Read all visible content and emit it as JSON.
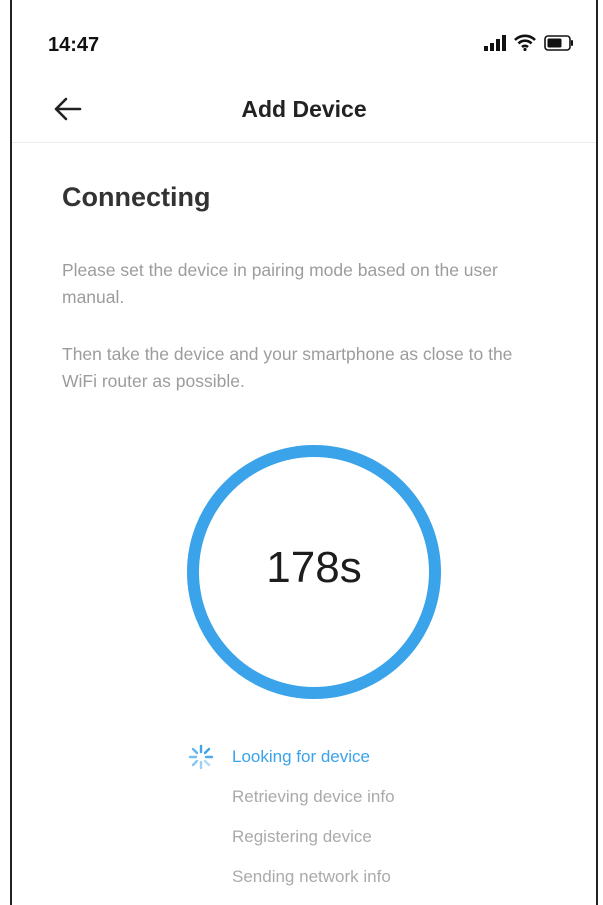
{
  "status": {
    "time": "14:47"
  },
  "header": {
    "title": "Add Device"
  },
  "content": {
    "heading": "Connecting",
    "instruction_1": "Please set the device in pairing mode based on the user manual.",
    "instruction_2": "Then take the device and your smartphone as close to the WiFi router as possible."
  },
  "timer": {
    "value": "178s"
  },
  "steps": [
    {
      "label": "Looking for device",
      "active": true
    },
    {
      "label": "Retrieving device info",
      "active": false
    },
    {
      "label": "Registering device",
      "active": false
    },
    {
      "label": "Sending network info",
      "active": false
    }
  ],
  "colors": {
    "accent": "#3aa3ea",
    "ring": "#3aa3ea",
    "muted_text": "#9c9c9c"
  },
  "icons": [
    "signal-icon",
    "wifi-icon",
    "battery-icon",
    "back-arrow-icon",
    "spinner-icon"
  ]
}
